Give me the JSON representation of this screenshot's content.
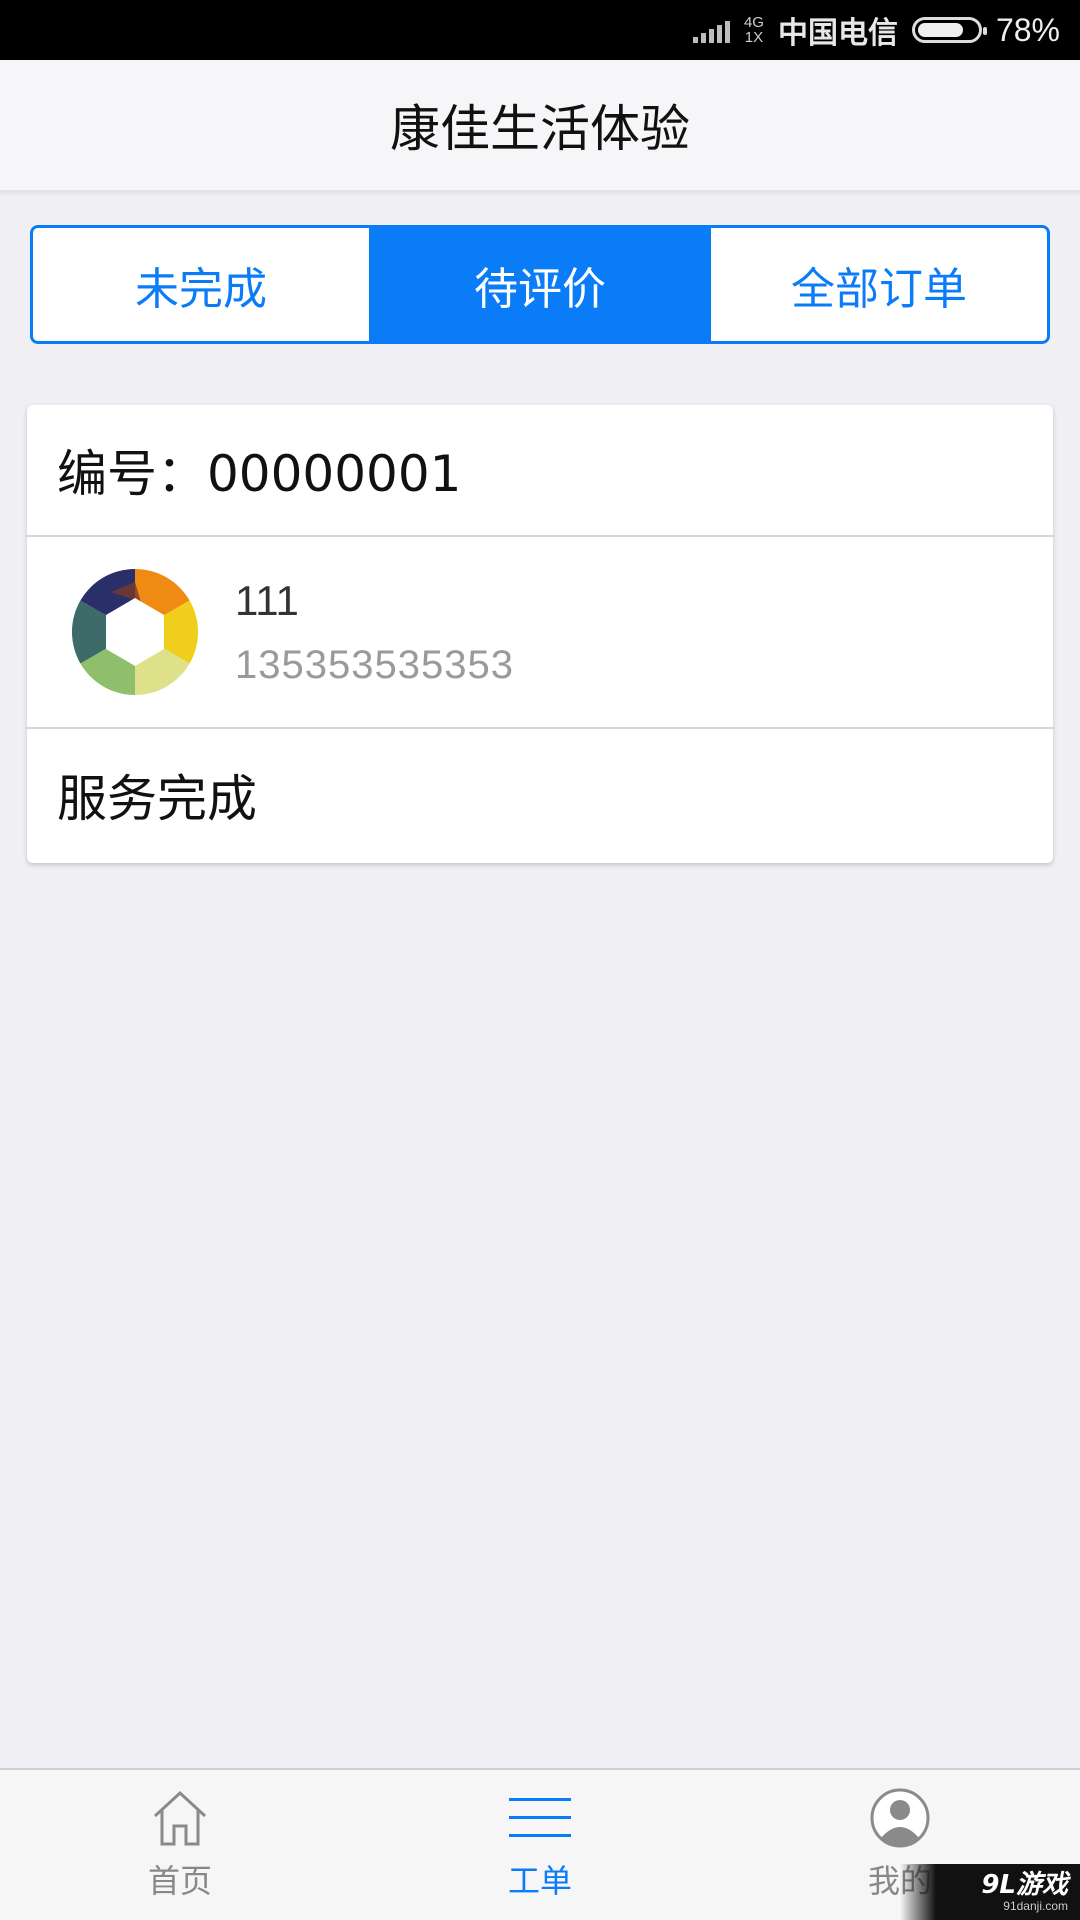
{
  "status_bar": {
    "network_top": "4G",
    "network_bottom": "1X",
    "carrier": "中国电信",
    "battery_percent_text": "78%",
    "battery_level": 0.78
  },
  "header": {
    "title": "康佳生活体验"
  },
  "tabs": [
    {
      "label": "未完成",
      "active": false
    },
    {
      "label": "待评价",
      "active": true
    },
    {
      "label": "全部订单",
      "active": false
    }
  ],
  "order": {
    "id_label": "编号：00000001",
    "customer_name": "111",
    "customer_phone": "135353535353",
    "status": "服务完成"
  },
  "tabbar": [
    {
      "label": "首页",
      "icon": "home-icon",
      "active": false
    },
    {
      "label": "工单",
      "icon": "list-icon",
      "active": true
    },
    {
      "label": "我的",
      "icon": "user-icon",
      "active": false
    }
  ],
  "watermark": {
    "logo": "9L游戏",
    "url": "91danji.com"
  },
  "colors": {
    "accent": "#0a7cf7",
    "background": "#efeff4",
    "status_bar": "#000000"
  }
}
